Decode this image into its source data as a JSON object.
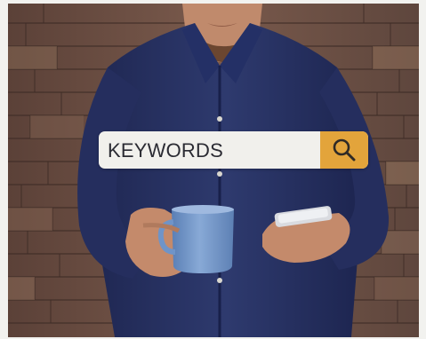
{
  "scene": {
    "description_icon": "magnifier-icon",
    "colors": {
      "search_bar": "#f1f0ec",
      "search_button": "#e3a43b",
      "shirt": "#2b3566",
      "mug": "#6f94c8",
      "brick_wall": "#6a4f45"
    }
  },
  "search": {
    "text": "KEYWORDS",
    "icon": "search-icon"
  }
}
